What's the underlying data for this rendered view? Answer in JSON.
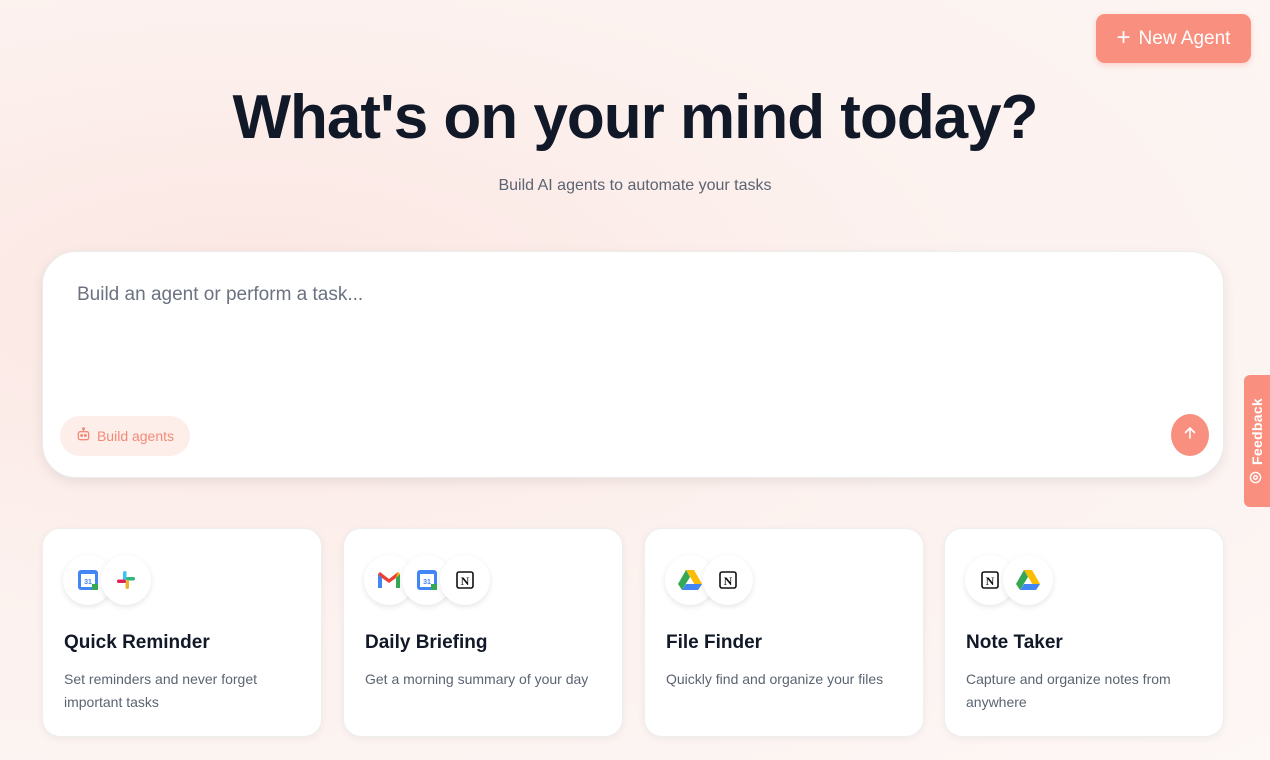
{
  "header": {
    "new_agent_label": "New Agent"
  },
  "hero": {
    "title": "What's on your mind today?",
    "subtitle": "Build AI agents to automate your tasks"
  },
  "prompt": {
    "placeholder": "Build an agent or perform a task...",
    "value": "",
    "chip_label": "Build agents"
  },
  "feedback": {
    "label": "Feedback"
  },
  "cards": [
    {
      "title": "Quick Reminder",
      "description": "Set reminders and never forget important tasks",
      "icons": [
        "google-calendar-icon",
        "slack-icon"
      ]
    },
    {
      "title": "Daily Briefing",
      "description": "Get a morning summary of your day",
      "icons": [
        "gmail-icon",
        "google-calendar-icon",
        "notion-icon"
      ]
    },
    {
      "title": "File Finder",
      "description": "Quickly find and organize your files",
      "icons": [
        "google-drive-icon",
        "notion-icon"
      ]
    },
    {
      "title": "Note Taker",
      "description": "Capture and organize notes from anywhere",
      "icons": [
        "notion-icon",
        "google-drive-icon"
      ]
    }
  ],
  "colors": {
    "accent": "#f98f7e",
    "chip_bg": "#fdeeea",
    "text": "#111827",
    "muted": "#5b6472"
  }
}
